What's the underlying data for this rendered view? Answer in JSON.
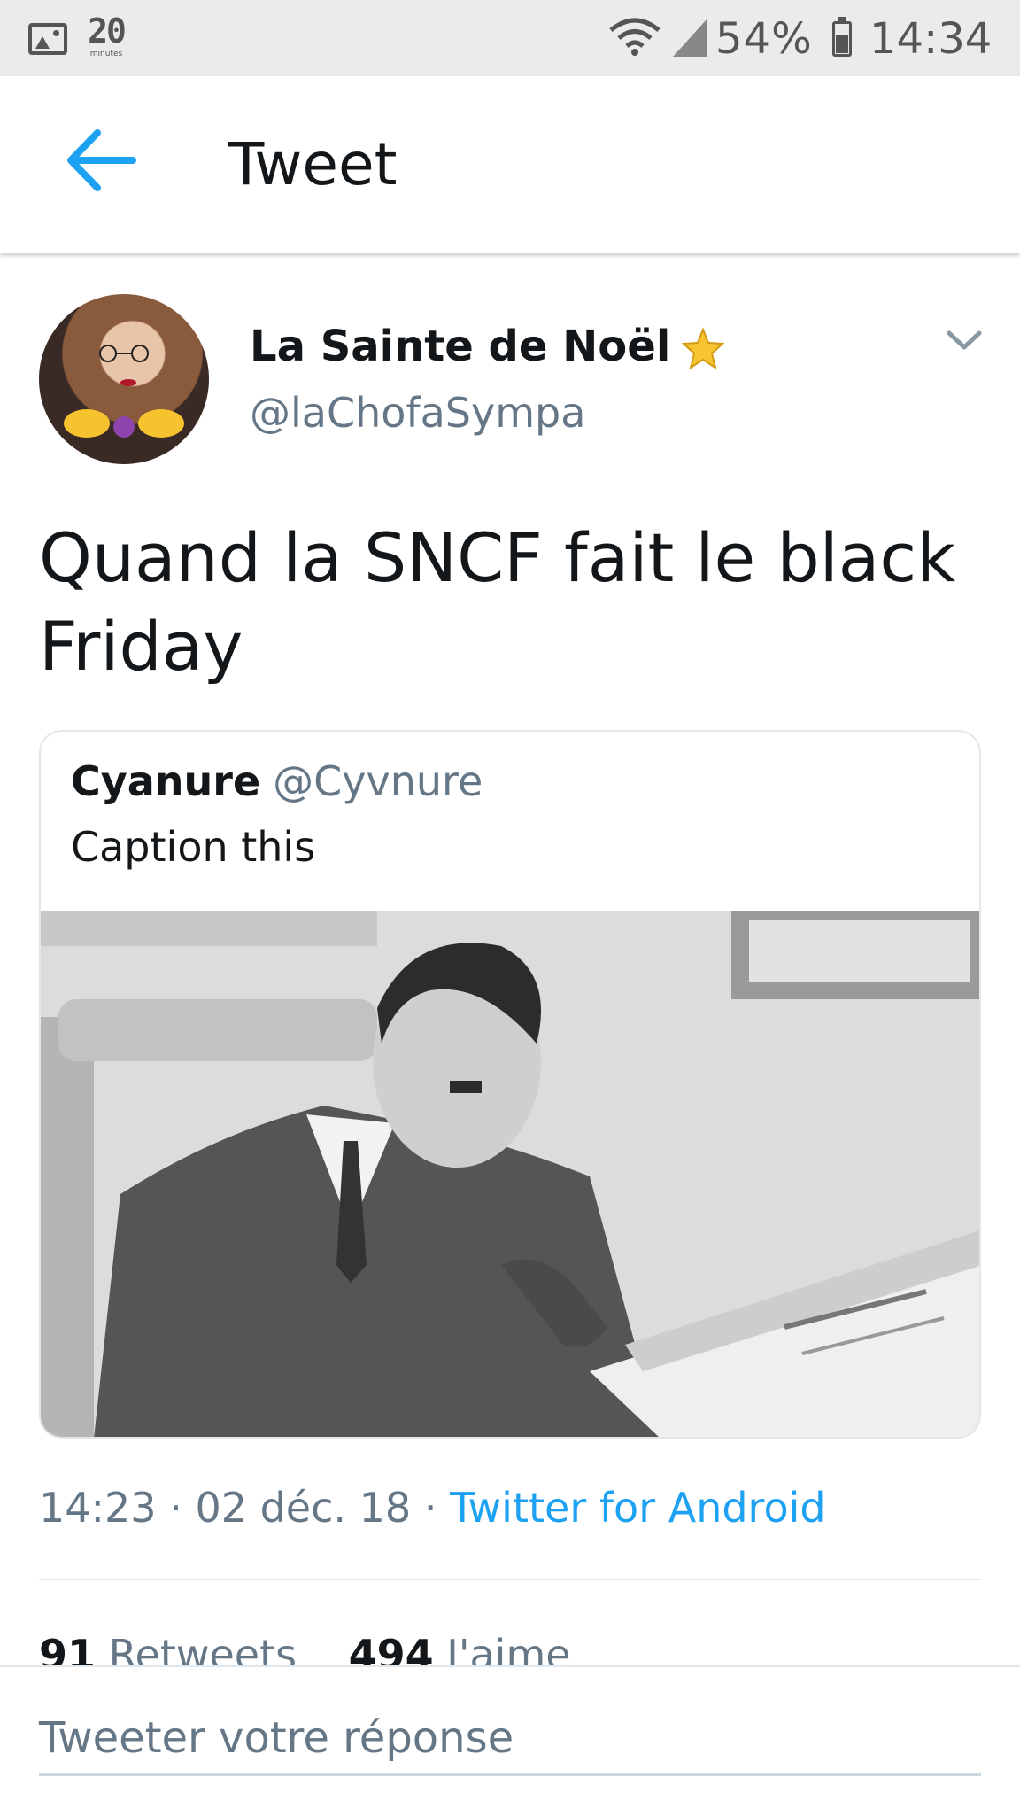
{
  "status_bar": {
    "app_icon_text": "20",
    "app_icon_subtext": "minutes",
    "battery_percent": "54%",
    "time": "14:34"
  },
  "header": {
    "title": "Tweet",
    "accent_color": "#1da1f2"
  },
  "tweet": {
    "author_name": "La Sainte de Noël",
    "author_handle": "@laChofaSympa",
    "text": "Quand la SNCF fait le black Friday",
    "quoted": {
      "author_name": "Cyanure",
      "author_handle": "@Cyvnure",
      "text": "Caption this"
    },
    "time": "14:23",
    "date": "02 déc. 18",
    "source": "Twitter for Android",
    "retweet_count": "91",
    "retweet_label": "Retweets",
    "like_count": "494",
    "like_label": "J'aime"
  },
  "reply": {
    "placeholder": "Tweeter votre réponse"
  },
  "icons": {
    "back": "arrow-left-icon",
    "verified": "star-icon",
    "menu": "chevron-down-icon"
  }
}
